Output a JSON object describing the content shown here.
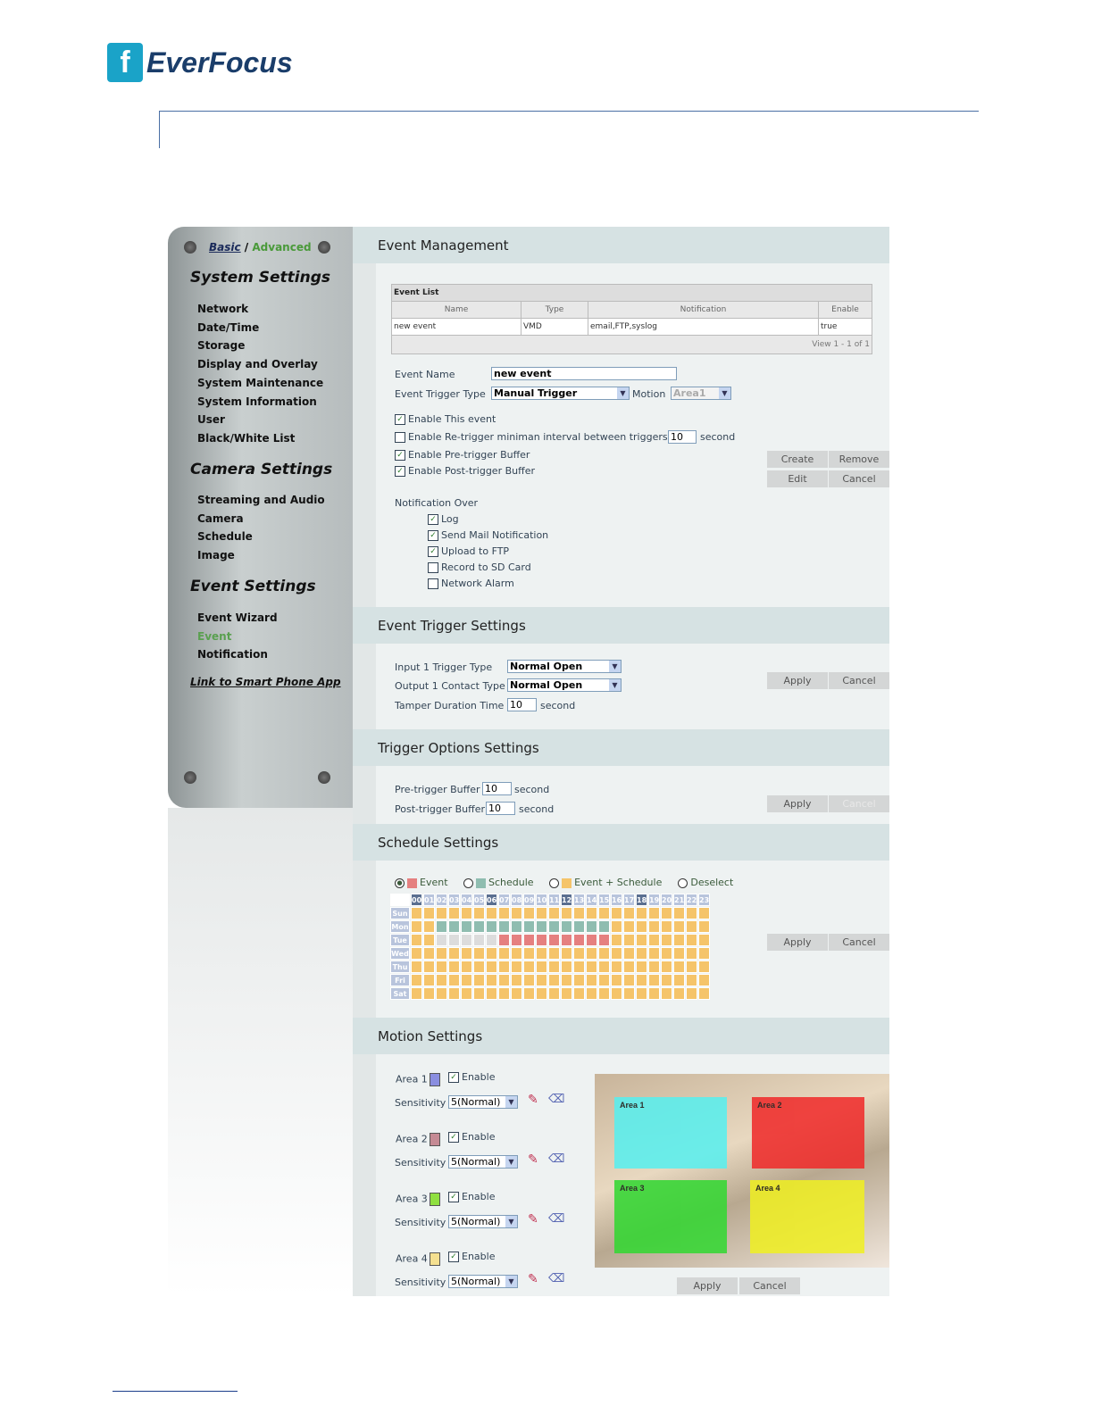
{
  "brand": "EverFocus",
  "sidebar": {
    "mode_basic": "Basic",
    "mode_sep": " / ",
    "mode_advanced": "Advanced",
    "system_title": "System Settings",
    "system_items": [
      "Network",
      "Date/Time",
      "Storage",
      "Display and Overlay",
      "System Maintenance",
      "System Information",
      "User",
      "Black/White List"
    ],
    "camera_title": "Camera Settings",
    "camera_items": [
      "Streaming and Audio",
      "Camera",
      "Schedule",
      "Image"
    ],
    "event_title": "Event Settings",
    "event_items": [
      "Event Wizard",
      "Event",
      "Notification"
    ],
    "link": "Link to Smart Phone App"
  },
  "event_mgmt": {
    "title": "Event Management",
    "list": {
      "caption": "Event List",
      "headers": [
        "Name",
        "Type",
        "Notification",
        "Enable"
      ],
      "rows": [
        [
          "new event",
          "VMD",
          "email,FTP,syslog",
          "true"
        ]
      ],
      "pager": "View 1 - 1 of 1"
    },
    "name_label": "Event Name",
    "name_value": "new event",
    "trigger_label": "Event Trigger Type",
    "trigger_value": "Manual Trigger",
    "motion_label": "Motion",
    "motion_value": "Area1",
    "enable_event": "Enable This event",
    "retrigger": "Enable Re-trigger miniman interval between triggers",
    "retrigger_value": "10",
    "retrigger_unit": "second",
    "pre_buffer": "Enable Pre-trigger Buffer",
    "post_buffer": "Enable Post-trigger Buffer",
    "buttons": {
      "create": "Create",
      "remove": "Remove",
      "edit": "Edit",
      "cancel": "Cancel"
    },
    "notify_title": "Notification Over",
    "notify": [
      {
        "label": "Log",
        "checked": true
      },
      {
        "label": "Send Mail Notification",
        "checked": true
      },
      {
        "label": "Upload to FTP",
        "checked": true
      },
      {
        "label": "Record to SD Card",
        "checked": false
      },
      {
        "label": "Network Alarm",
        "checked": false
      }
    ]
  },
  "trigger_settings": {
    "title": "Event Trigger Settings",
    "input_label": "Input 1 Trigger Type",
    "input_value": "Normal Open",
    "output_label": "Output 1 Contact Type",
    "output_value": "Normal Open",
    "tamper_label": "Tamper Duration Time",
    "tamper_value": "10",
    "tamper_unit": "second",
    "apply": "Apply",
    "cancel": "Cancel"
  },
  "trigger_options": {
    "title": "Trigger Options Settings",
    "pre_label": "Pre-trigger Buffer",
    "pre_value": "10",
    "post_label": "Post-trigger Buffer",
    "post_value": "10",
    "unit": "second",
    "apply": "Apply",
    "cancel": "Cancel"
  },
  "schedule": {
    "title": "Schedule Settings",
    "legend": [
      "Event",
      "Schedule",
      "Event + Schedule",
      "Deselect"
    ],
    "selected": "Event",
    "colors": {
      "event": "#e58080",
      "schedule": "#8fbdb0",
      "both": "#f5c46a",
      "none": "#dcdcdc"
    },
    "hours": [
      "00",
      "01",
      "02",
      "03",
      "04",
      "05",
      "06",
      "07",
      "08",
      "09",
      "10",
      "11",
      "12",
      "13",
      "14",
      "15",
      "16",
      "17",
      "18",
      "19",
      "20",
      "21",
      "22",
      "23"
    ],
    "days": [
      "Sun",
      "Mon",
      "Tue",
      "Wed",
      "Thu",
      "Fri",
      "Sat"
    ],
    "grid": {
      "Mon": {
        "schedule": [
          2,
          15
        ]
      },
      "Tue": {
        "none": [
          2,
          6
        ],
        "event": [
          7,
          15
        ]
      }
    },
    "apply": "Apply",
    "cancel": "Cancel"
  },
  "motion": {
    "title": "Motion Settings",
    "sensitivity_label": "Sensitivity",
    "enable_label": "Enable",
    "areas": [
      {
        "label": "Area 1",
        "color": "#8a8ee0",
        "zone": "#55f0f0",
        "sensitivity": "5(Normal)"
      },
      {
        "label": "Area 2",
        "color": "#c58a94",
        "zone": "#f02828",
        "sensitivity": "5(Normal)"
      },
      {
        "label": "Area 3",
        "color": "#90e040",
        "zone": "#30d830",
        "sensitivity": "5(Normal)"
      },
      {
        "label": "Area 4",
        "color": "#f5e090",
        "zone": "#f0f020",
        "sensitivity": "5(Normal)"
      }
    ],
    "zone_labels": [
      "Area 1",
      "Area 2",
      "Area 3",
      "Area 4"
    ],
    "apply": "Apply",
    "cancel": "Cancel"
  }
}
